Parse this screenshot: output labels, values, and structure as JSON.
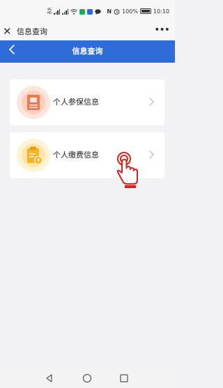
{
  "status_bar": {
    "sim_labels": [
      "4G",
      "HD"
    ],
    "nfc_label": "N",
    "battery_text": "100%",
    "time": "10:10"
  },
  "title_bar": {
    "close_icon": "close-icon",
    "title": "信息查询",
    "more_icon": "more-dots-icon"
  },
  "header": {
    "back_icon": "chevron-left-icon",
    "title": "信息查询"
  },
  "cards": [
    {
      "label": "个人参保信息",
      "icon": "insurance-document-icon",
      "icon_colors": {
        "bg": "#fde5dc",
        "main": "#f2774a"
      }
    },
    {
      "label": "个人缴费信息",
      "icon": "payment-clipboard-icon",
      "icon_colors": {
        "bg": "#fff3d6",
        "main": "#f6b424"
      }
    }
  ],
  "colors": {
    "brand_blue": "#2f6bd9",
    "page_bg": "#f2f2f4",
    "pointer_red": "#d8231b"
  },
  "nav_bar": {
    "icons": [
      "back-triangle-icon",
      "home-circle-icon",
      "recent-square-icon"
    ]
  }
}
